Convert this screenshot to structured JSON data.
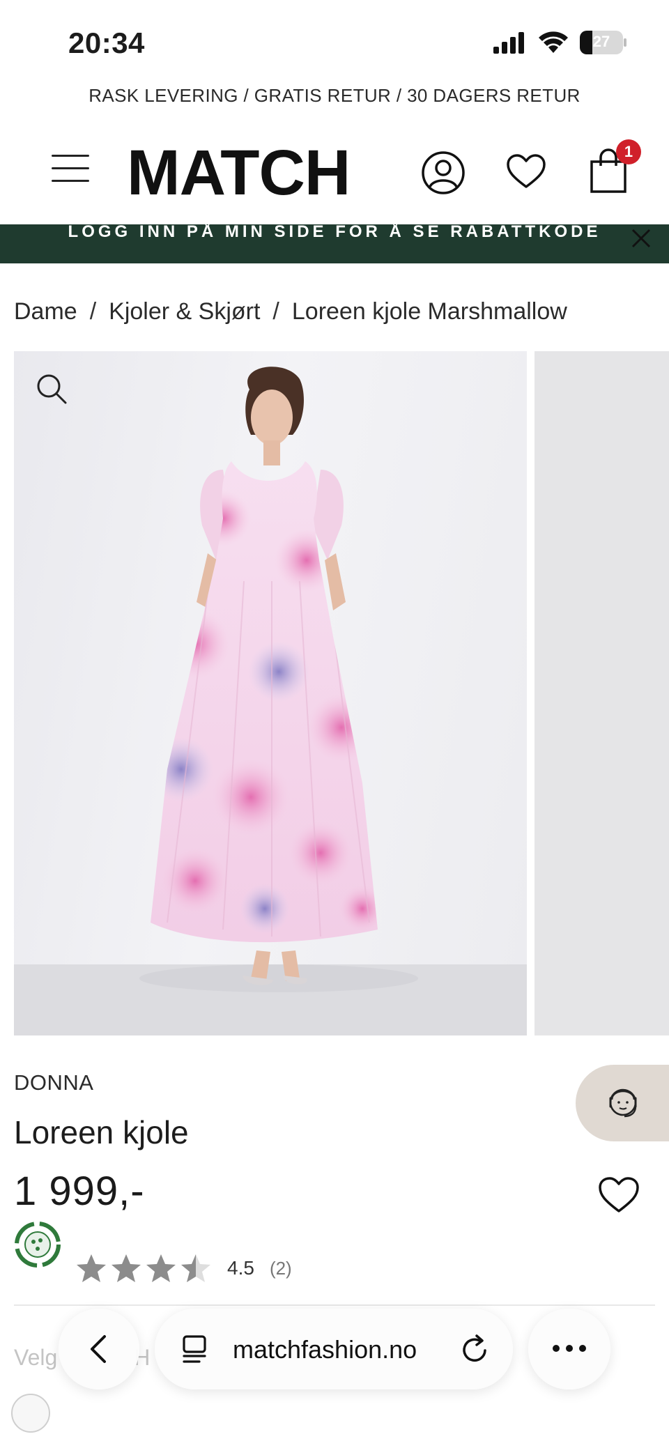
{
  "status_bar": {
    "time": "20:34",
    "battery": "27"
  },
  "promo": {
    "text": "RASK LEVERING / GRATIS RETUR / 30 DAGERS RETUR"
  },
  "header": {
    "logo": "MATCH",
    "cart_count": "1"
  },
  "login_banner": {
    "text": "LOGG INN PÅ MIN SIDE FOR Å SE RABATTKODE"
  },
  "breadcrumb": {
    "items": [
      "Dame",
      "Kjoler & Skjørt",
      "Loreen kjole Marshmallow"
    ],
    "separator": "/"
  },
  "product": {
    "brand": "DONNA",
    "name": "Loreen kjole",
    "price": "1 999,-",
    "rating_value": "4.5",
    "rating_count": "(2)",
    "rating": 4.5,
    "rating_max": 5
  },
  "below": {
    "label_faded": "Velg",
    "label_faded_2": "H"
  },
  "browser": {
    "url": "matchfashion.no"
  },
  "colors": {
    "banner_bg": "#1f3b2f",
    "badge": "#d0202a",
    "support_bg": "#e0d9d2",
    "eco_green": "#2f7a3b"
  },
  "icons": [
    "menu-icon",
    "account-icon",
    "heart-icon",
    "cart-icon",
    "close-icon",
    "search-icon",
    "support-agent-icon",
    "eco-icon",
    "star-icon",
    "back-icon",
    "tabs-icon",
    "reload-icon",
    "more-icon"
  ]
}
